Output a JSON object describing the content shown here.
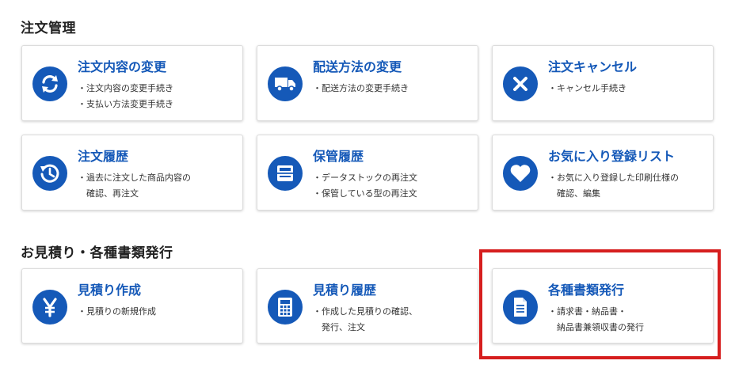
{
  "sections": {
    "orders": "注文管理",
    "estimates": "お見積り・各種書類発行"
  },
  "cards": {
    "change_order": {
      "title": "注文内容の変更",
      "lines": [
        "・注文内容の変更手続き",
        "・支払い方法変更手続き"
      ],
      "icon": "refresh-icon"
    },
    "change_shipping": {
      "title": "配送方法の変更",
      "lines": [
        "・配送方法の変更手続き"
      ],
      "icon": "truck-icon"
    },
    "cancel": {
      "title": "注文キャンセル",
      "lines": [
        "・キャンセル手続き"
      ],
      "icon": "close-icon"
    },
    "history": {
      "title": "注文履歴",
      "lines": [
        "・過去に注文した商品内容の",
        "　確認、再注文"
      ],
      "icon": "history-icon"
    },
    "storage": {
      "title": "保管履歴",
      "lines": [
        "・データストックの再注文",
        "・保管している型の再注文"
      ],
      "icon": "storage-icon"
    },
    "favorites": {
      "title": "お気に入り登録リスト",
      "lines": [
        "・お気に入り登録した印刷仕様の",
        "　確認、編集"
      ],
      "icon": "heart-icon"
    },
    "create_estimate": {
      "title": "見積り作成",
      "lines": [
        "・見積りの新規作成"
      ],
      "icon": "yen-icon"
    },
    "estimate_history": {
      "title": "見積り履歴",
      "lines": [
        "・作成した見積りの確認、",
        "　発行、注文"
      ],
      "icon": "calculator-icon"
    },
    "documents": {
      "title": "各種書類発行",
      "lines": [
        "・請求書・納品書・",
        "　納品書兼領収書の発行"
      ],
      "icon": "document-icon"
    }
  },
  "colors": {
    "accent": "#1559b8",
    "highlight": "#d61e1e"
  }
}
